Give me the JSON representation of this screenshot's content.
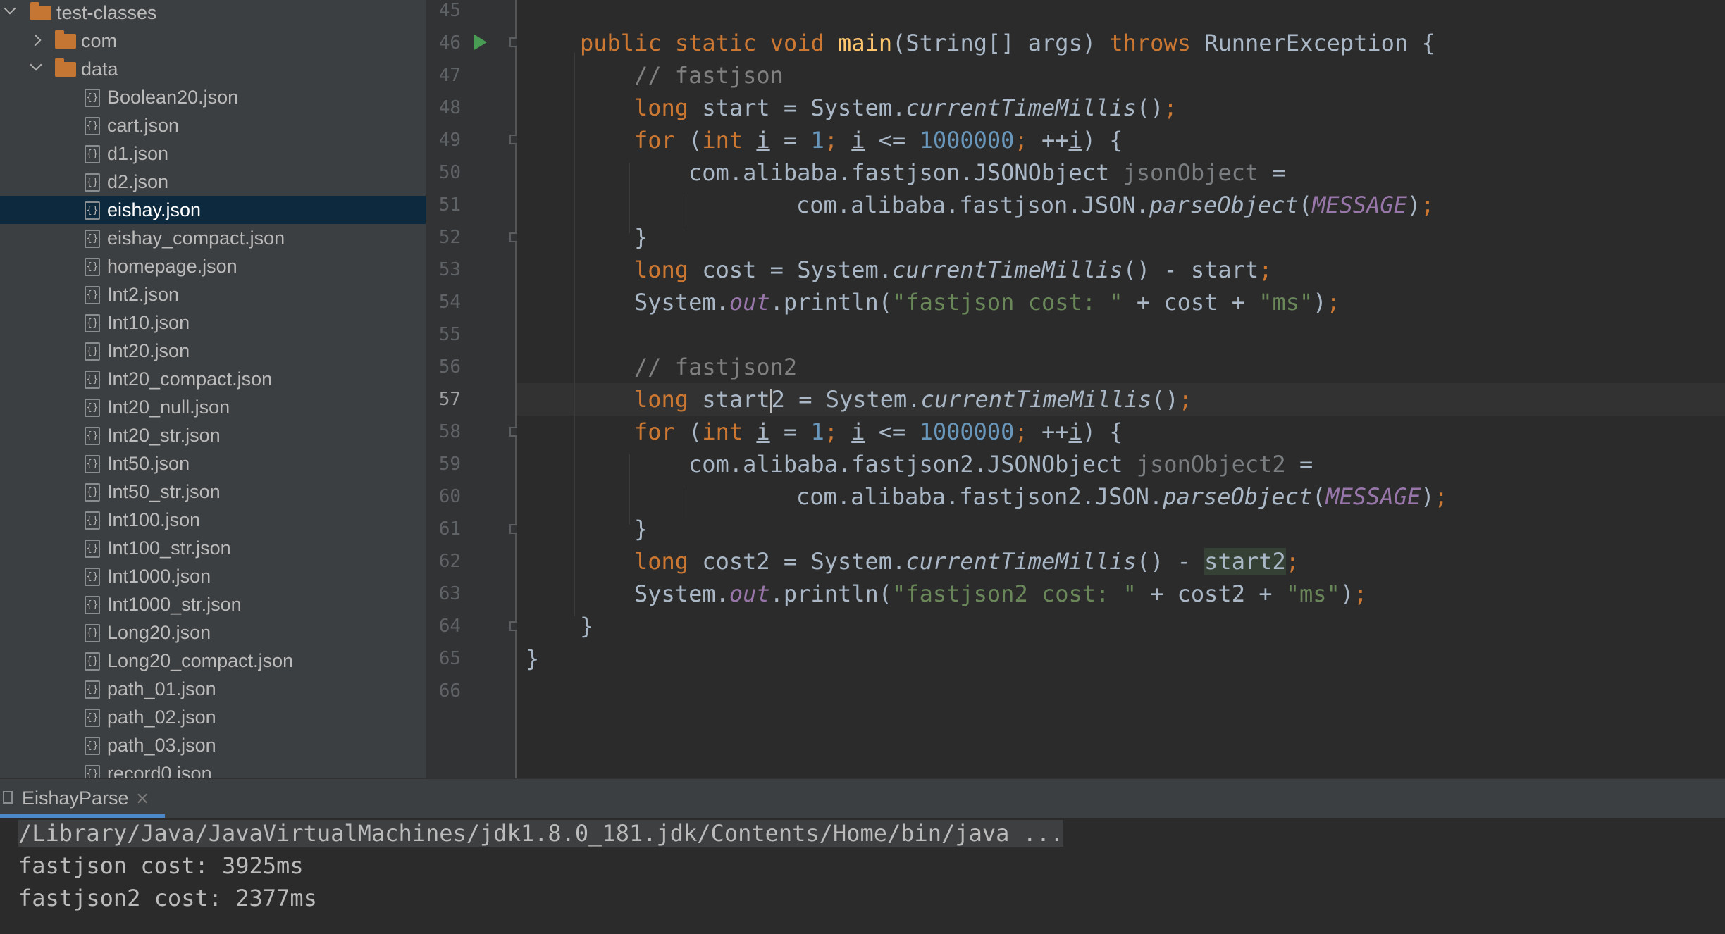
{
  "project_tree": {
    "root_folder": "test-classes",
    "subfolders": [
      "com",
      "data"
    ],
    "files": [
      "Boolean20.json",
      "cart.json",
      "d1.json",
      "d2.json",
      "eishay.json",
      "eishay_compact.json",
      "homepage.json",
      "Int2.json",
      "Int10.json",
      "Int20.json",
      "Int20_compact.json",
      "Int20_null.json",
      "Int20_str.json",
      "Int50.json",
      "Int50_str.json",
      "Int100.json",
      "Int100_str.json",
      "Int1000.json",
      "Int1000_str.json",
      "Long20.json",
      "Long20_compact.json",
      "path_01.json",
      "path_02.json",
      "path_03.json",
      "record0.json"
    ],
    "selected_file": "eishay.json",
    "file_icon_glyph": "{}"
  },
  "editor": {
    "line_numbers": [
      "45",
      "46",
      "47",
      "48",
      "49",
      "50",
      "51",
      "52",
      "53",
      "54",
      "55",
      "56",
      "57",
      "58",
      "59",
      "60",
      "61",
      "62",
      "63",
      "64",
      "65",
      "66"
    ],
    "current_line": "57",
    "code": {
      "l46": {
        "public": "public",
        "static": "static",
        "void": "void",
        "main": "main",
        "sig": "(String[] args) ",
        "throws": "throws",
        "exc": " RunnerException {"
      },
      "l47": {
        "comment": "// fastjson"
      },
      "l48": {
        "long": "long",
        "decl": " start = System.",
        "method": "currentTimeMillis",
        "rest": "()",
        "semi": ";"
      },
      "l49": {
        "for": "for",
        "open": " (",
        "int": "int",
        "sp": " ",
        "i1": "i",
        "eq": " = ",
        "one": "1",
        "semi1": ";",
        "sp2": " ",
        "i2": "i",
        "le": " <= ",
        "million": "1000000",
        "semi2": ";",
        "inc": " ++",
        "i3": "i",
        "close": ") {"
      },
      "l50": {
        "type": "com.alibaba.fastjson.JSONObject ",
        "var": "jsonObject",
        "eq": " ="
      },
      "l51": {
        "call": "com.alibaba.fastjson.JSON.",
        "method": "parseObject",
        "open": "(",
        "const": "MESSAGE",
        "close": ")",
        "semi": ";"
      },
      "l52": {
        "brace": "}"
      },
      "l53": {
        "long": "long",
        "decl": " cost = System.",
        "method": "currentTimeMillis",
        "rest": "() - start",
        "semi": ";"
      },
      "l54": {
        "sys": "System.",
        "out": "out",
        "println": ".println(",
        "str1": "\"fastjson cost: \"",
        "plus": " + cost + ",
        "str2": "\"ms\"",
        "close": ")",
        "semi": ";"
      },
      "l56": {
        "comment": "// fastjson2"
      },
      "l57": {
        "long": "long",
        "decl_a": " start",
        "decl_b": "2 = System.",
        "method": "currentTimeMillis",
        "rest": "()",
        "semi": ";"
      },
      "l58": {
        "for": "for",
        "open": " (",
        "int": "int",
        "sp": " ",
        "i1": "i",
        "eq": " = ",
        "one": "1",
        "semi1": ";",
        "sp2": " ",
        "i2": "i",
        "le": " <= ",
        "million": "1000000",
        "semi2": ";",
        "inc": " ++",
        "i3": "i",
        "close": ") {"
      },
      "l59": {
        "type": "com.alibaba.fastjson2.JSONObject ",
        "var": "jsonObject2",
        "eq": " ="
      },
      "l60": {
        "call": "com.alibaba.fastjson2.JSON.",
        "method": "parseObject",
        "open": "(",
        "const": "MESSAGE",
        "close": ")",
        "semi": ";"
      },
      "l61": {
        "brace": "}"
      },
      "l62": {
        "long": "long",
        "decl": " cost2 = System.",
        "method": "currentTimeMillis",
        "rest": "() - ",
        "hl": "start2",
        "semi": ";"
      },
      "l63": {
        "sys": "System.",
        "out": "out",
        "println": ".println(",
        "str1": "\"fastjson2 cost: \"",
        "plus": " + cost2 + ",
        "str2": "\"ms\"",
        "close": ")",
        "semi": ";"
      },
      "l64": {
        "brace": "}"
      },
      "l65": {
        "brace": "}"
      }
    }
  },
  "run_panel": {
    "tab_label": "EishayParse",
    "close_glyph": "×",
    "command": "/Library/Java/JavaVirtualMachines/jdk1.8.0_181.jdk/Contents/Home/bin/java ...",
    "output": [
      "fastjson cost: 3925ms",
      "fastjson2 cost: 2377ms"
    ]
  },
  "colors": {
    "keyword": "#cc7832",
    "method_decl": "#ffc66d",
    "number": "#6897bb",
    "string": "#6a8759",
    "comment": "#808080",
    "static_field": "#9876aa",
    "selection": "#0d293e",
    "folder": "#c57633",
    "run_icon": "#499c54"
  }
}
